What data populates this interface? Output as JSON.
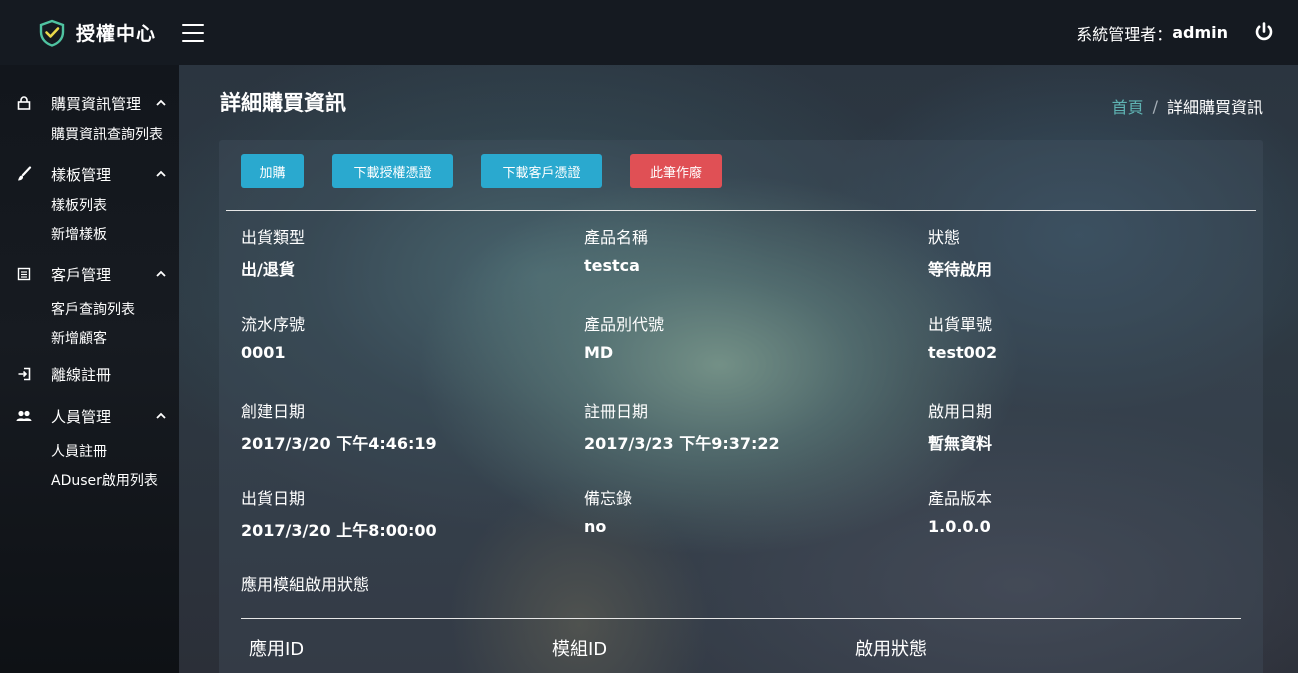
{
  "app": {
    "title": "授權中心"
  },
  "header": {
    "user_label": "系統管理者：",
    "user_name": "admin"
  },
  "sidebar": {
    "groups": [
      {
        "label": "購買資訊管理",
        "icon": "lock-icon",
        "items": [
          "購買資訊查詢列表"
        ]
      },
      {
        "label": "樣板管理",
        "icon": "brush-icon",
        "items": [
          "樣板列表",
          "新增樣板"
        ]
      },
      {
        "label": "客戶管理",
        "icon": "list-icon",
        "items": [
          "客戶查詢列表",
          "新增顧客"
        ]
      },
      {
        "label": "離線註冊",
        "icon": "sign-in-icon",
        "items": []
      },
      {
        "label": "人員管理",
        "icon": "users-icon",
        "items": [
          "人員註冊",
          "ADuser啟用列表"
        ]
      }
    ]
  },
  "page": {
    "title": "詳細購買資訊",
    "breadcrumb": {
      "home": "首頁",
      "separator": "/",
      "current": "詳細購買資訊"
    }
  },
  "actions": {
    "add": "加購",
    "download_license": "下載授權憑證",
    "download_customer": "下載客戶憑證",
    "void": "此筆作廢"
  },
  "details": [
    {
      "label": "出貨類型",
      "value": "出/退貨"
    },
    {
      "label": "產品名稱",
      "value": "testca"
    },
    {
      "label": "狀態",
      "value": "等待啟用"
    },
    {
      "label": "流水序號",
      "value": "0001"
    },
    {
      "label": "產品別代號",
      "value": "MD"
    },
    {
      "label": "出貨單號",
      "value": "test002"
    },
    {
      "label": "創建日期",
      "value": "2017/3/20 下午4:46:19"
    },
    {
      "label": "註冊日期",
      "value": "2017/3/23 下午9:37:22"
    },
    {
      "label": "啟用日期",
      "value": "暫無資料"
    },
    {
      "label": "出貨日期",
      "value": "2017/3/20 上午8:00:00"
    },
    {
      "label": "備忘錄",
      "value": "no"
    },
    {
      "label": "產品版本",
      "value": "1.0.0.0"
    }
  ],
  "module_section": {
    "title": "應用模組啟用狀態",
    "columns": [
      "應用ID",
      "模組ID",
      "啟用狀態"
    ]
  },
  "colors": {
    "accent_blue": "#2aa9cf",
    "danger_red": "#e05055",
    "brand_green": "#4fc3a1",
    "breadcrumb_link": "#5fb3b3"
  }
}
